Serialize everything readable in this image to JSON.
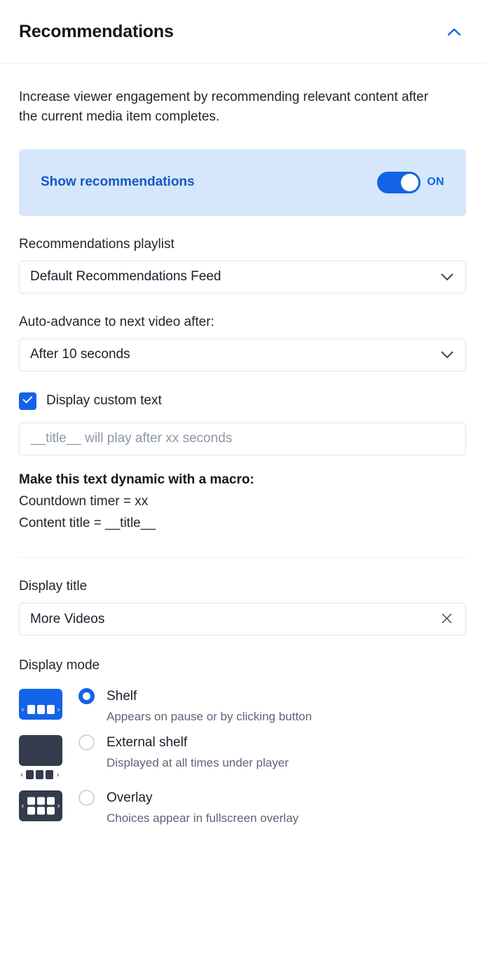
{
  "header": {
    "title": "Recommendations",
    "collapse_icon": "chevron-up-icon"
  },
  "intro": "Increase viewer engagement by recommending relevant content after the current media item completes.",
  "show_recommendations": {
    "label": "Show recommendations",
    "state": "ON",
    "enabled": true
  },
  "playlist": {
    "label": "Recommendations playlist",
    "value": "Default Recommendations Feed",
    "chevron_icon": "chevron-down-icon"
  },
  "auto_advance": {
    "label": "Auto-advance to next video after:",
    "value": "After 10 seconds",
    "chevron_icon": "chevron-down-icon"
  },
  "custom_text": {
    "checkbox_label": "Display custom text",
    "checked": true,
    "check_icon": "check-icon",
    "input_placeholder": "__title__ will play after xx seconds",
    "input_value": ""
  },
  "macro": {
    "title": "Make this text dynamic with a macro:",
    "lines": [
      "Countdown timer = xx",
      "Content title = __title__"
    ]
  },
  "display_title": {
    "label": "Display title",
    "value": "More Videos",
    "clear_icon": "close-icon"
  },
  "display_mode": {
    "label": "Display mode",
    "selected": "Shelf",
    "options": [
      {
        "name": "Shelf",
        "description": "Appears on pause or by clicking button",
        "selected": true,
        "thumbnail": "shelf-thumbnail"
      },
      {
        "name": "External shelf",
        "description": "Displayed at all times under player",
        "selected": false,
        "thumbnail": "external-shelf-thumbnail"
      },
      {
        "name": "Overlay",
        "description": "Choices appear in fullscreen overlay",
        "selected": false,
        "thumbnail": "overlay-thumbnail"
      }
    ]
  },
  "colors": {
    "accent": "#1263e8",
    "accent_text": "#1558c0",
    "highlight_bg": "#d6e7fb",
    "thumb_dark": "#333b4d",
    "muted_text": "#5b6577"
  }
}
